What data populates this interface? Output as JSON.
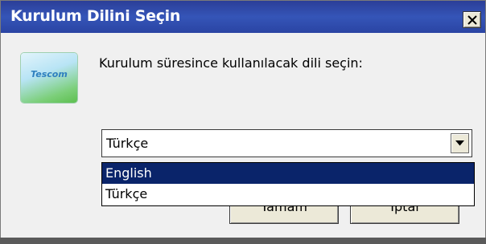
{
  "window": {
    "title": "Kurulum Dilini Seçin"
  },
  "logo": {
    "text": "Tescom"
  },
  "prompt": "Kurulum süresince kullanılacak dili seçin:",
  "language_select": {
    "value": "Türkçe",
    "options": [
      {
        "label": "English",
        "highlighted": true
      },
      {
        "label": "Türkçe",
        "highlighted": false
      }
    ]
  },
  "buttons": {
    "ok_label": "Tamam",
    "cancel_label": "İptal"
  },
  "colors": {
    "titlebar": "#2b3e98",
    "selection": "#0a246a",
    "face": "#f0f0f0"
  }
}
